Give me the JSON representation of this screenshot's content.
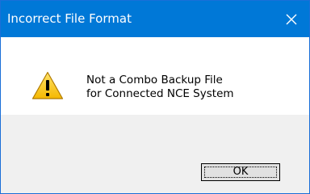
{
  "window": {
    "title": "Incorrect File Format",
    "close_icon": "close-icon",
    "title_bar_color": "#0078d7"
  },
  "message": {
    "icon": "warning-icon",
    "line1": "Not a Combo Backup File",
    "line2": "for Connected NCE System"
  },
  "buttons": {
    "ok_label": "OK"
  }
}
